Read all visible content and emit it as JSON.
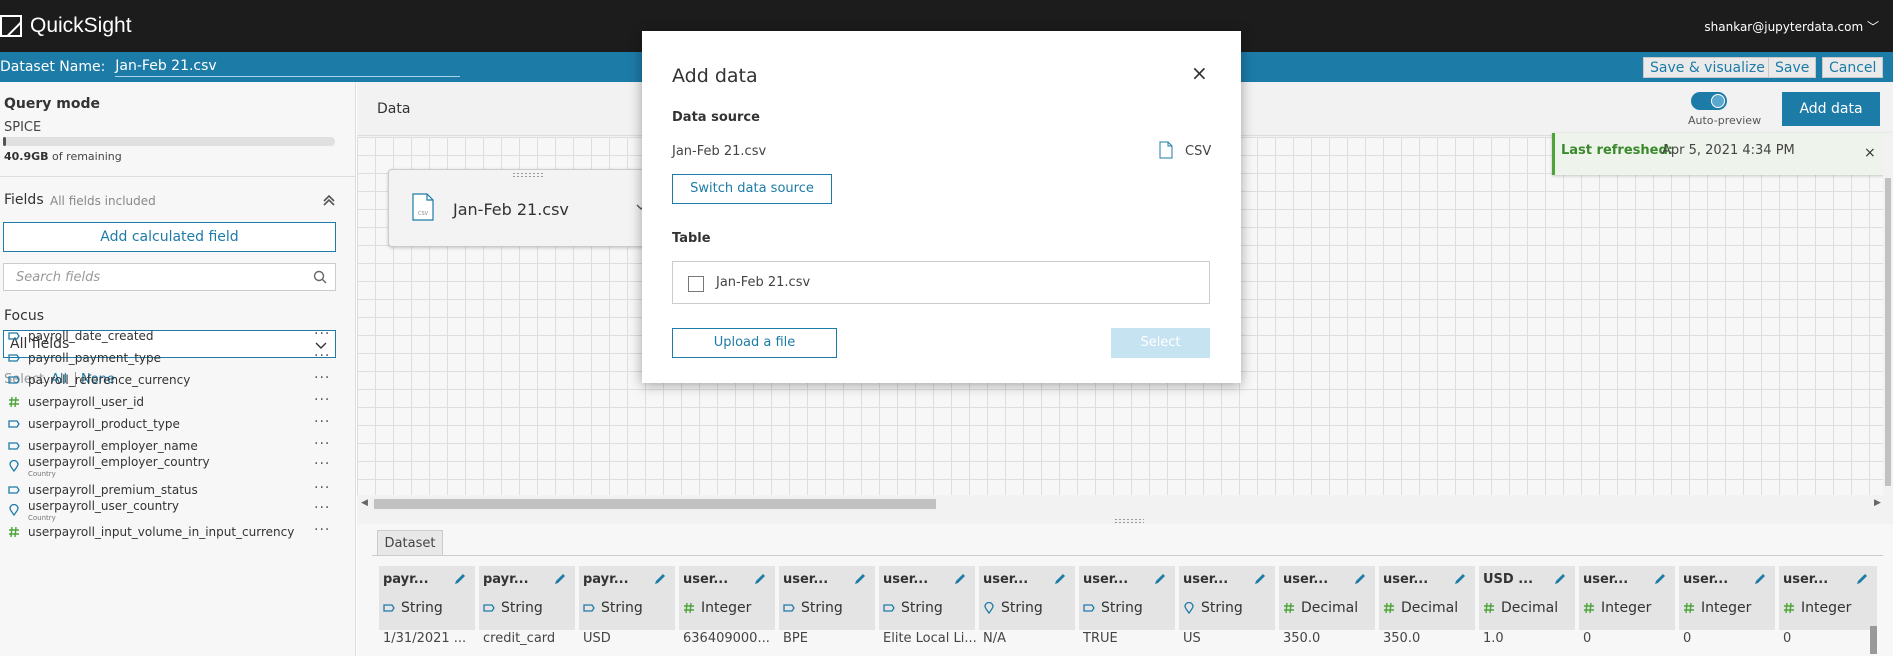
{
  "app": {
    "name": "QuickSight",
    "user": "shankar@jupyterdata.com ﹀"
  },
  "dataset_bar": {
    "label": "Dataset Name:",
    "name": "Jan-Feb 21.csv",
    "save_visualize": "Save & visualize",
    "save": "Save",
    "cancel": "Cancel"
  },
  "query_mode": {
    "title": "Query mode",
    "mode": "SPICE",
    "remaining_value": "40.9GB",
    "remaining_suffix": " of remaining",
    "usage_fraction": 0.01
  },
  "fields_panel": {
    "title": "Fields",
    "subtitle": "All fields included",
    "add_calc": "Add calculated field",
    "search_placeholder": "Search fields",
    "focus_label": "Focus",
    "focus_value": "All fields",
    "select_label": "Select",
    "select_all": "All",
    "select_none": "None",
    "more": "···",
    "items": [
      {
        "name": "payroll_date_created",
        "type": "string",
        "sub": ""
      },
      {
        "name": "payroll_payment_type",
        "type": "string",
        "sub": ""
      },
      {
        "name": "payroll_reference_currency",
        "type": "string",
        "sub": ""
      },
      {
        "name": "userpayroll_user_id",
        "type": "number",
        "sub": ""
      },
      {
        "name": "userpayroll_product_type",
        "type": "string",
        "sub": ""
      },
      {
        "name": "userpayroll_employer_name",
        "type": "string",
        "sub": ""
      },
      {
        "name": "userpayroll_employer_country",
        "type": "geo",
        "sub": "Country"
      },
      {
        "name": "userpayroll_premium_status",
        "type": "string",
        "sub": ""
      },
      {
        "name": "userpayroll_user_country",
        "type": "geo",
        "sub": "Country"
      },
      {
        "name": "userpayroll_input_volume_in_input_currency",
        "type": "number",
        "sub": ""
      }
    ]
  },
  "data_header": {
    "label": "Data",
    "auto_preview": "Auto-preview",
    "add_data": "Add data"
  },
  "node": {
    "name": "Jan-Feb 21.csv",
    "icon_label": "CSV"
  },
  "refreshed": {
    "label": "Last refreshed:",
    "value": "Apr 5, 2021 4:34 PM",
    "close": "×"
  },
  "dataset_tab": "Dataset",
  "columns": [
    {
      "header": "payr...",
      "type": "String",
      "icon": "string",
      "cell": "1/31/2021 ..."
    },
    {
      "header": "payr...",
      "type": "String",
      "icon": "string",
      "cell": "credit_card"
    },
    {
      "header": "payr...",
      "type": "String",
      "icon": "string",
      "cell": "USD"
    },
    {
      "header": "user...",
      "type": "Integer",
      "icon": "number",
      "cell": "636409000..."
    },
    {
      "header": "user...",
      "type": "String",
      "icon": "string",
      "cell": "BPE"
    },
    {
      "header": "user...",
      "type": "String",
      "icon": "string",
      "cell": "Elite Local Li..."
    },
    {
      "header": "user...",
      "type": "String",
      "icon": "geo",
      "cell": "N/A"
    },
    {
      "header": "user...",
      "type": "String",
      "icon": "string",
      "cell": "TRUE"
    },
    {
      "header": "user...",
      "type": "String",
      "icon": "geo",
      "cell": "US"
    },
    {
      "header": "user...",
      "type": "Decimal",
      "icon": "number",
      "cell": "350.0"
    },
    {
      "header": "user...",
      "type": "Decimal",
      "icon": "number",
      "cell": "350.0"
    },
    {
      "header": "USD ...",
      "type": "Decimal",
      "icon": "number",
      "cell": "1.0"
    },
    {
      "header": "user...",
      "type": "Integer",
      "icon": "number",
      "cell": "0"
    },
    {
      "header": "user...",
      "type": "Integer",
      "icon": "number",
      "cell": "0"
    },
    {
      "header": "user...",
      "type": "Integer",
      "icon": "number",
      "cell": "0"
    }
  ],
  "modal": {
    "title": "Add data",
    "close": "×",
    "data_source_label": "Data source",
    "data_source_name": "Jan-Feb 21.csv",
    "data_source_type": "CSV",
    "switch_label": "Switch data source",
    "table_label": "Table",
    "table_name": "Jan-Feb 21.csv",
    "upload_label": "Upload a file",
    "select_label": "Select"
  },
  "colors": {
    "accent": "#1d7ba8",
    "topbar": "#1c1c1c",
    "success": "#3a8a2c",
    "number_icon": "#4ea33b"
  }
}
